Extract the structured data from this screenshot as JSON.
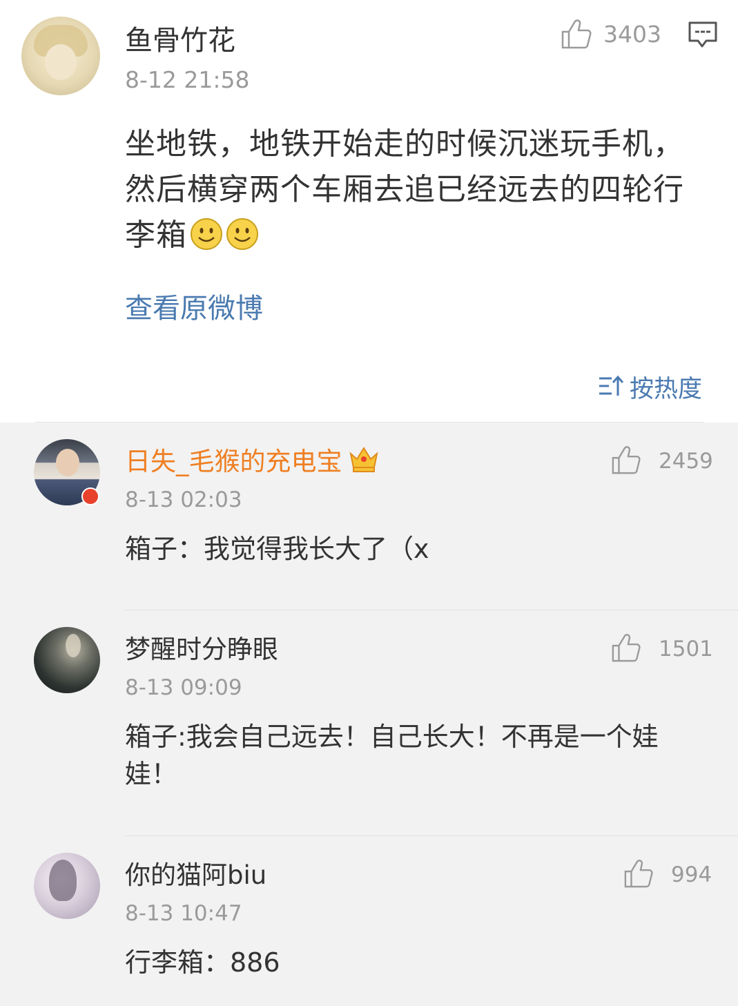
{
  "main_post": {
    "author": "鱼骨竹花",
    "time": "8-12 21:58",
    "like_count": "3403",
    "text": "坐地铁，地铁开始走的时候沉迷玩手机，然后横穿两个车厢去追已经远去的四轮行李箱",
    "emoji": [
      "smiley-face",
      "smiley-face"
    ],
    "view_original_label": "查看原微博",
    "sort_label": "按热度",
    "icons": {
      "like": "thumbs-up-icon",
      "comment": "comment-icon",
      "sort": "sort-icon"
    }
  },
  "comments": [
    {
      "author": "日失_毛猴的充电宝",
      "author_color": "#ef7f22",
      "badge": "crown-member-icon",
      "time": "8-13 02:03",
      "like_count": "2459",
      "text": "箱子：我觉得我长大了（x"
    },
    {
      "author": "梦醒时分睁眼",
      "time": "8-13 09:09",
      "like_count": "1501",
      "text": "箱子:我会自己远去！自己长大！不再是一个娃娃！"
    },
    {
      "author": "你的猫阿biu",
      "time": "8-13 10:47",
      "like_count": "994",
      "text": "行李箱：886"
    }
  ],
  "colors": {
    "link_blue": "#4a7ab0",
    "vip_orange": "#ef7f22",
    "meta_gray": "#9a9a9a",
    "comment_bg": "#f2f2f2"
  }
}
